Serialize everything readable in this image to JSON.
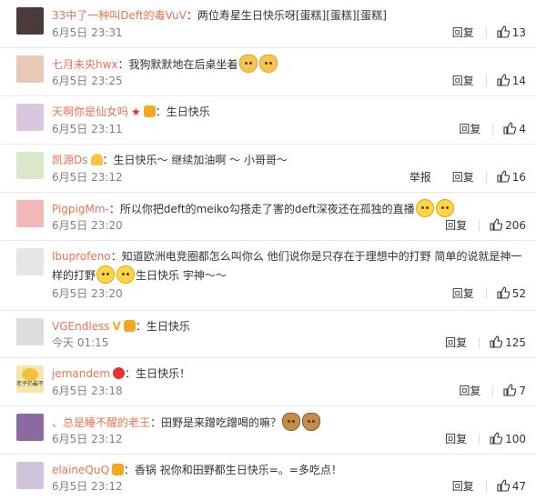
{
  "actions": {
    "reply": "回复",
    "report": "举报"
  },
  "comments": [
    {
      "user": "33中了一种叫Deft的毒VuV",
      "text": "：两位寿星生日快乐呀[蛋糕][蛋糕][蛋糕]",
      "time": "6月5日 23:31",
      "likes": "13",
      "avatar_color": "#4a3a3a"
    },
    {
      "user": "七月未央hwx",
      "text": "：我狗默默地在后桌坐着",
      "time": "6月5日 23:25",
      "likes": "14",
      "avatar_color": "#e8c9b8"
    },
    {
      "user": "天啊你是仙女吗",
      "text": "：生日快乐",
      "time": "6月5日 23:11",
      "likes": "4",
      "avatar_color": "#d9c7e0"
    },
    {
      "user": "凯源Ds",
      "text": "：生日快乐～ 继续加油啊 ～ 小哥哥～",
      "time": "6月5日 23:12",
      "likes": "16",
      "avatar_color": "#d8e8c8"
    },
    {
      "user": "PigpigMm-",
      "text": "：所以你把deft的meiko勾搭走了害的deft深夜还在孤独的直播",
      "time": "6月5日 23:20",
      "likes": "206",
      "avatar_color": "#f2b8b8"
    },
    {
      "user": "lbuprofeno",
      "text": "：知道欧洲电竞圈都怎么叫你么 他们说你是只存在于理想中的打野 简单的说就是神一",
      "text2": "样的打野",
      "text3": "生日快乐 宇神～～",
      "time": "6月5日 23:20",
      "likes": "52",
      "avatar_color": "#e6e6e6"
    },
    {
      "user": "VGEndless",
      "text": "：生日快乐",
      "time": "今天 01:15",
      "likes": "125",
      "avatar_color": "#dddddd"
    },
    {
      "user": "jemandem",
      "text": "：生日快乐！",
      "time": "6月5日 23:18",
      "likes": "7",
      "avatar_color": "#f5e6b0",
      "avatar_caption": "老子仍最不"
    },
    {
      "user": "、总是睡不醒的老王",
      "text": "：田野是来蹭吃蹭喝的嘛？",
      "time": "6月5日 23:12",
      "likes": "100",
      "avatar_color": "#8a6aa0"
    },
    {
      "user": "elaineQuQ",
      "text": "：香锅 祝你和田野都生日快乐=。=多吃点！",
      "time": "6月5日 23:12",
      "likes": "47",
      "avatar_color": "#cfc4dc"
    }
  ],
  "colors": {
    "username": "#eb7350",
    "meta": "#808080",
    "divider": "#e9e9e9"
  }
}
